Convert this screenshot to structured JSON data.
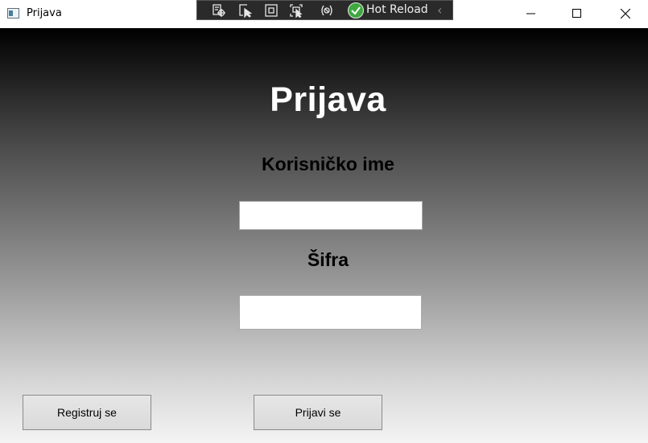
{
  "window": {
    "title": "Prijava",
    "controls": [
      "minimize",
      "maximize",
      "close"
    ]
  },
  "debug_toolbar": {
    "icons": [
      "live-visual-tree-icon",
      "select-element-icon",
      "display-layout-adorners-icon",
      "track-focused-element-icon",
      "binding-failures-icon"
    ],
    "hot_reload_label": "Hot Reload",
    "hot_reload_status": "ok"
  },
  "form": {
    "title": "Prijava",
    "username_label": "Korisničko ime",
    "username_value": "",
    "password_label": "Šifra",
    "password_value": ""
  },
  "buttons": {
    "register_label": "Registruj se",
    "login_label": "Prijavi se"
  },
  "colors": {
    "gradient_top": "#000000",
    "gradient_bottom": "#f4f4f4",
    "title_text": "#ffffff",
    "label_text": "#000000",
    "hot_reload_ok": "#3fa83f"
  }
}
